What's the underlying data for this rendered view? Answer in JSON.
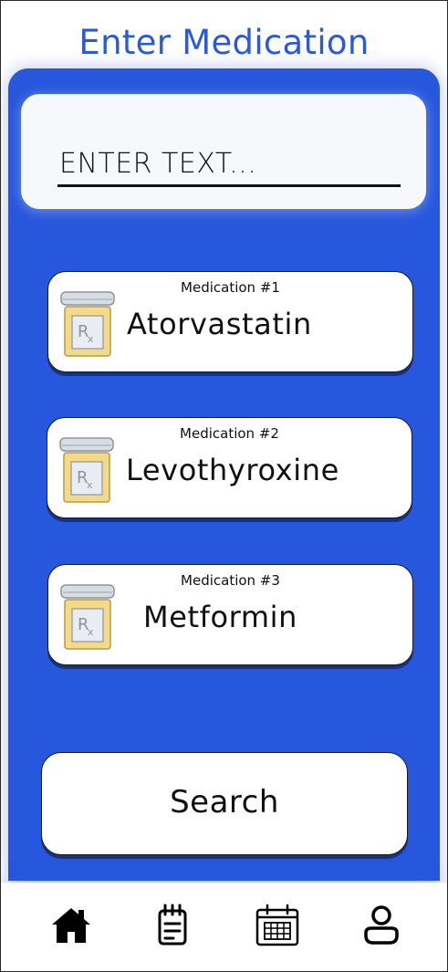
{
  "header": {
    "title": "Enter Medication"
  },
  "search": {
    "placeholder": "ENTER TEXT..."
  },
  "medications": [
    {
      "label": "Medication #1",
      "name": "Atorvastatin"
    },
    {
      "label": "Medication #2",
      "name": "Levothyroxine"
    },
    {
      "label": "Medication #3",
      "name": "Metformin"
    }
  ],
  "actions": {
    "search_label": "Search"
  },
  "nav": {
    "items": [
      {
        "icon": "home-icon"
      },
      {
        "icon": "notes-icon"
      },
      {
        "icon": "calendar-icon"
      },
      {
        "icon": "profile-icon"
      }
    ]
  },
  "colors": {
    "accent": "#2757dc",
    "title": "#2b5ad9",
    "pill_bottle_body": "#f3d98a",
    "pill_bottle_cap": "#d8dde3"
  }
}
